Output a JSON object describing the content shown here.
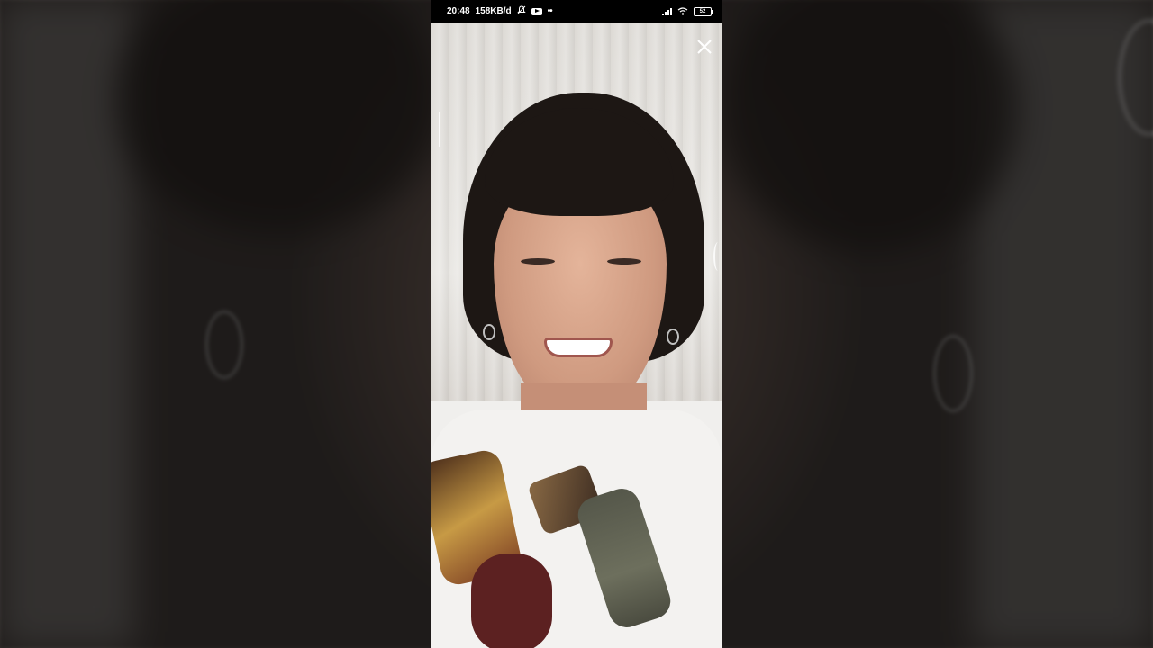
{
  "status_bar": {
    "time": "20:48",
    "network_speed": "158KB/d",
    "battery_level": "52",
    "icons": [
      "bell-off-icon",
      "youtube-icon",
      "more-dots-icon",
      "signal-icon",
      "wifi-icon",
      "battery-icon"
    ]
  },
  "player": {
    "close_icon": "close-icon"
  },
  "colors": {
    "status_bar_bg": "#000000",
    "status_text": "#ffffff"
  }
}
